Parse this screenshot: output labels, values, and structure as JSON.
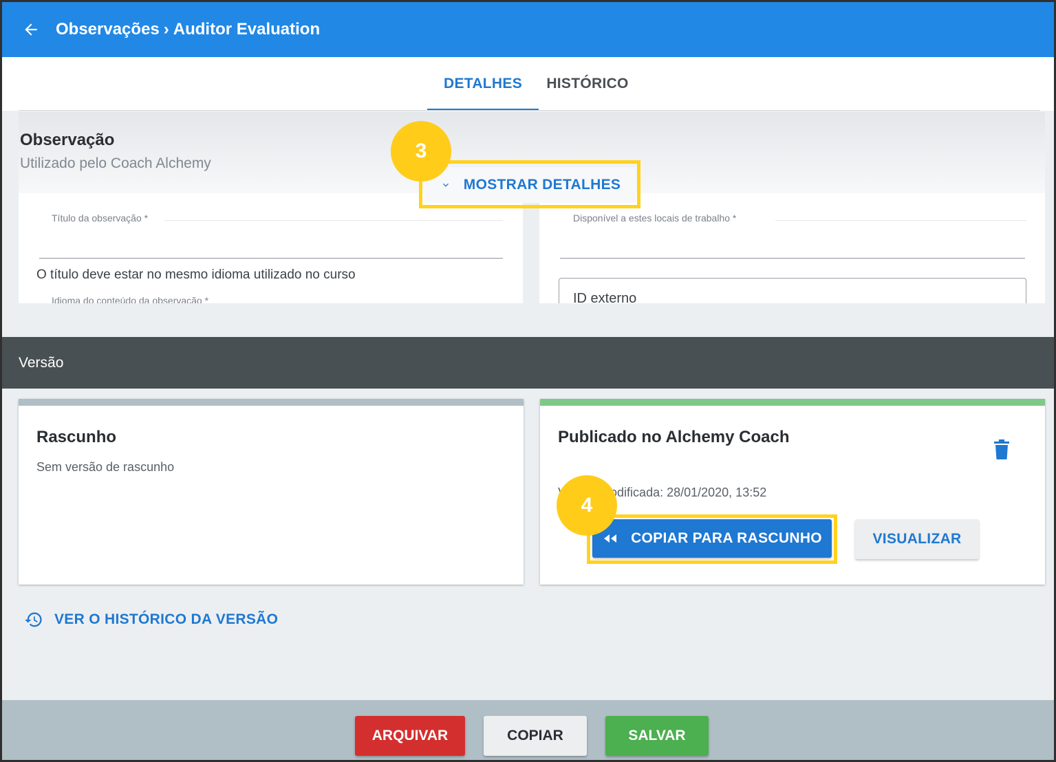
{
  "header": {
    "breadcrumb_parent": "Observações",
    "breadcrumb_separator": "›",
    "breadcrumb_current": "Auditor Evaluation",
    "back_icon": "arrow-left-icon"
  },
  "tabs": [
    {
      "label": "DETALHES",
      "active": true
    },
    {
      "label": "HISTÓRICO",
      "active": false
    }
  ],
  "observation": {
    "title": "Observação",
    "subtitle": "Utilizado pelo Coach Alchemy",
    "show_details_label": "MOSTRAR DETALHES",
    "title_field_label": "Título da observação *",
    "title_hint": "O título deve estar no mesmo idioma utilizado no curso",
    "language_field_label": "Idioma do conteúdo da observação *",
    "locations_field_label": "Disponível a estes locais de trabalho *",
    "external_id_label": "ID externo"
  },
  "callouts": {
    "step3": "3",
    "step4": "4"
  },
  "version": {
    "header": "Versão",
    "draft": {
      "title": "Rascunho",
      "text": "Sem versão de rascunho"
    },
    "published": {
      "title": "Publicado no Alchemy Coach",
      "modified_text": "Versão modificada: 28/01/2020, 13:52",
      "copy_button": "COPIAR PARA RASCUNHO",
      "view_button": "VISUALIZAR"
    },
    "history_link": "VER O HISTÓRICO DA VERSÃO"
  },
  "footer": {
    "archive": "ARQUIVAR",
    "copy": "COPIAR",
    "save": "SALVAR"
  },
  "colors": {
    "primary": "#1f78d1",
    "header": "#2188e6",
    "version_bar": "#495053",
    "highlight": "#ffd21f",
    "archive": "#d32f2f",
    "save": "#4caf50",
    "published_strip": "#7ec987",
    "draft_strip": "#b0bec5"
  }
}
